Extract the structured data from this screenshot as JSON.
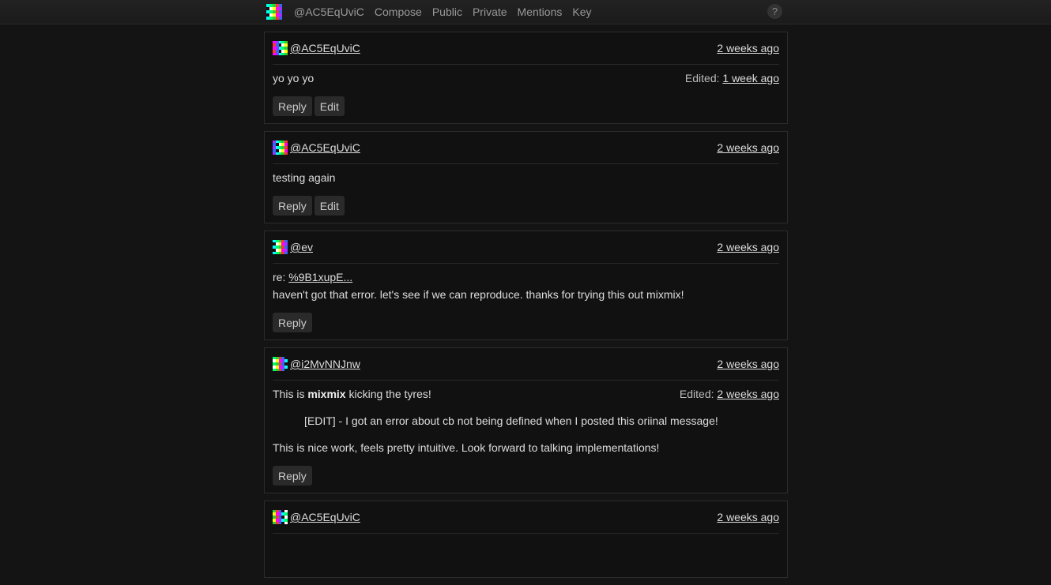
{
  "nav": {
    "handle": "@AC5EqUviC",
    "links": [
      "Compose",
      "Public",
      "Private",
      "Mentions",
      "Key"
    ],
    "help": "?"
  },
  "messages": [
    {
      "author": "@AC5EqUviC",
      "time": "2 weeks ago",
      "edited_label": "Edited:",
      "edited_time": "1 week ago",
      "text": "yo yo yo",
      "actions": [
        "Reply",
        "Edit"
      ]
    },
    {
      "author": "@AC5EqUviC",
      "time": "2 weeks ago",
      "text": "testing again",
      "actions": [
        "Reply",
        "Edit"
      ]
    },
    {
      "author": "@ev",
      "time": "2 weeks ago",
      "re_label": "re:",
      "re_link": "%9B1xupE...",
      "text": "haven't got that error. let's see if we can reproduce. thanks for trying this out mixmix!",
      "actions": [
        "Reply"
      ]
    },
    {
      "author": "@i2MvNNJnw",
      "time": "2 weeks ago",
      "edited_label": "Edited:",
      "edited_time": "2 weeks ago",
      "text_pre": "This is ",
      "text_bold": "mixmix",
      "text_post": " kicking the tyres!",
      "quote": "[EDIT] - I got an error about cb not being defined when I posted this oriinal message!",
      "text2": "This is nice work, feels pretty intuitive. Look forward to talking implementations!",
      "actions": [
        "Reply"
      ]
    },
    {
      "author": "@AC5EqUviC",
      "time": "2 weeks ago"
    }
  ]
}
